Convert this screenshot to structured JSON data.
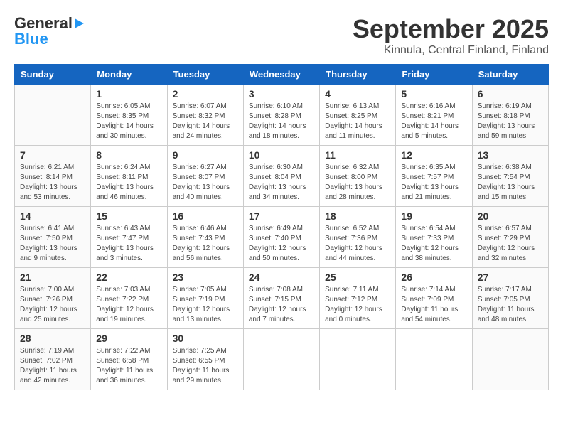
{
  "header": {
    "logo_line1": "General",
    "logo_line2": "Blue",
    "month": "September 2025",
    "location": "Kinnula, Central Finland, Finland"
  },
  "calendar": {
    "weekdays": [
      "Sunday",
      "Monday",
      "Tuesday",
      "Wednesday",
      "Thursday",
      "Friday",
      "Saturday"
    ],
    "weeks": [
      [
        {
          "day": "",
          "info": ""
        },
        {
          "day": "1",
          "info": "Sunrise: 6:05 AM\nSunset: 8:35 PM\nDaylight: 14 hours\nand 30 minutes."
        },
        {
          "day": "2",
          "info": "Sunrise: 6:07 AM\nSunset: 8:32 PM\nDaylight: 14 hours\nand 24 minutes."
        },
        {
          "day": "3",
          "info": "Sunrise: 6:10 AM\nSunset: 8:28 PM\nDaylight: 14 hours\nand 18 minutes."
        },
        {
          "day": "4",
          "info": "Sunrise: 6:13 AM\nSunset: 8:25 PM\nDaylight: 14 hours\nand 11 minutes."
        },
        {
          "day": "5",
          "info": "Sunrise: 6:16 AM\nSunset: 8:21 PM\nDaylight: 14 hours\nand 5 minutes."
        },
        {
          "day": "6",
          "info": "Sunrise: 6:19 AM\nSunset: 8:18 PM\nDaylight: 13 hours\nand 59 minutes."
        }
      ],
      [
        {
          "day": "7",
          "info": "Sunrise: 6:21 AM\nSunset: 8:14 PM\nDaylight: 13 hours\nand 53 minutes."
        },
        {
          "day": "8",
          "info": "Sunrise: 6:24 AM\nSunset: 8:11 PM\nDaylight: 13 hours\nand 46 minutes."
        },
        {
          "day": "9",
          "info": "Sunrise: 6:27 AM\nSunset: 8:07 PM\nDaylight: 13 hours\nand 40 minutes."
        },
        {
          "day": "10",
          "info": "Sunrise: 6:30 AM\nSunset: 8:04 PM\nDaylight: 13 hours\nand 34 minutes."
        },
        {
          "day": "11",
          "info": "Sunrise: 6:32 AM\nSunset: 8:00 PM\nDaylight: 13 hours\nand 28 minutes."
        },
        {
          "day": "12",
          "info": "Sunrise: 6:35 AM\nSunset: 7:57 PM\nDaylight: 13 hours\nand 21 minutes."
        },
        {
          "day": "13",
          "info": "Sunrise: 6:38 AM\nSunset: 7:54 PM\nDaylight: 13 hours\nand 15 minutes."
        }
      ],
      [
        {
          "day": "14",
          "info": "Sunrise: 6:41 AM\nSunset: 7:50 PM\nDaylight: 13 hours\nand 9 minutes."
        },
        {
          "day": "15",
          "info": "Sunrise: 6:43 AM\nSunset: 7:47 PM\nDaylight: 13 hours\nand 3 minutes."
        },
        {
          "day": "16",
          "info": "Sunrise: 6:46 AM\nSunset: 7:43 PM\nDaylight: 12 hours\nand 56 minutes."
        },
        {
          "day": "17",
          "info": "Sunrise: 6:49 AM\nSunset: 7:40 PM\nDaylight: 12 hours\nand 50 minutes."
        },
        {
          "day": "18",
          "info": "Sunrise: 6:52 AM\nSunset: 7:36 PM\nDaylight: 12 hours\nand 44 minutes."
        },
        {
          "day": "19",
          "info": "Sunrise: 6:54 AM\nSunset: 7:33 PM\nDaylight: 12 hours\nand 38 minutes."
        },
        {
          "day": "20",
          "info": "Sunrise: 6:57 AM\nSunset: 7:29 PM\nDaylight: 12 hours\nand 32 minutes."
        }
      ],
      [
        {
          "day": "21",
          "info": "Sunrise: 7:00 AM\nSunset: 7:26 PM\nDaylight: 12 hours\nand 25 minutes."
        },
        {
          "day": "22",
          "info": "Sunrise: 7:03 AM\nSunset: 7:22 PM\nDaylight: 12 hours\nand 19 minutes."
        },
        {
          "day": "23",
          "info": "Sunrise: 7:05 AM\nSunset: 7:19 PM\nDaylight: 12 hours\nand 13 minutes."
        },
        {
          "day": "24",
          "info": "Sunrise: 7:08 AM\nSunset: 7:15 PM\nDaylight: 12 hours\nand 7 minutes."
        },
        {
          "day": "25",
          "info": "Sunrise: 7:11 AM\nSunset: 7:12 PM\nDaylight: 12 hours\nand 0 minutes."
        },
        {
          "day": "26",
          "info": "Sunrise: 7:14 AM\nSunset: 7:09 PM\nDaylight: 11 hours\nand 54 minutes."
        },
        {
          "day": "27",
          "info": "Sunrise: 7:17 AM\nSunset: 7:05 PM\nDaylight: 11 hours\nand 48 minutes."
        }
      ],
      [
        {
          "day": "28",
          "info": "Sunrise: 7:19 AM\nSunset: 7:02 PM\nDaylight: 11 hours\nand 42 minutes."
        },
        {
          "day": "29",
          "info": "Sunrise: 7:22 AM\nSunset: 6:58 PM\nDaylight: 11 hours\nand 36 minutes."
        },
        {
          "day": "30",
          "info": "Sunrise: 7:25 AM\nSunset: 6:55 PM\nDaylight: 11 hours\nand 29 minutes."
        },
        {
          "day": "",
          "info": ""
        },
        {
          "day": "",
          "info": ""
        },
        {
          "day": "",
          "info": ""
        },
        {
          "day": "",
          "info": ""
        }
      ]
    ]
  }
}
